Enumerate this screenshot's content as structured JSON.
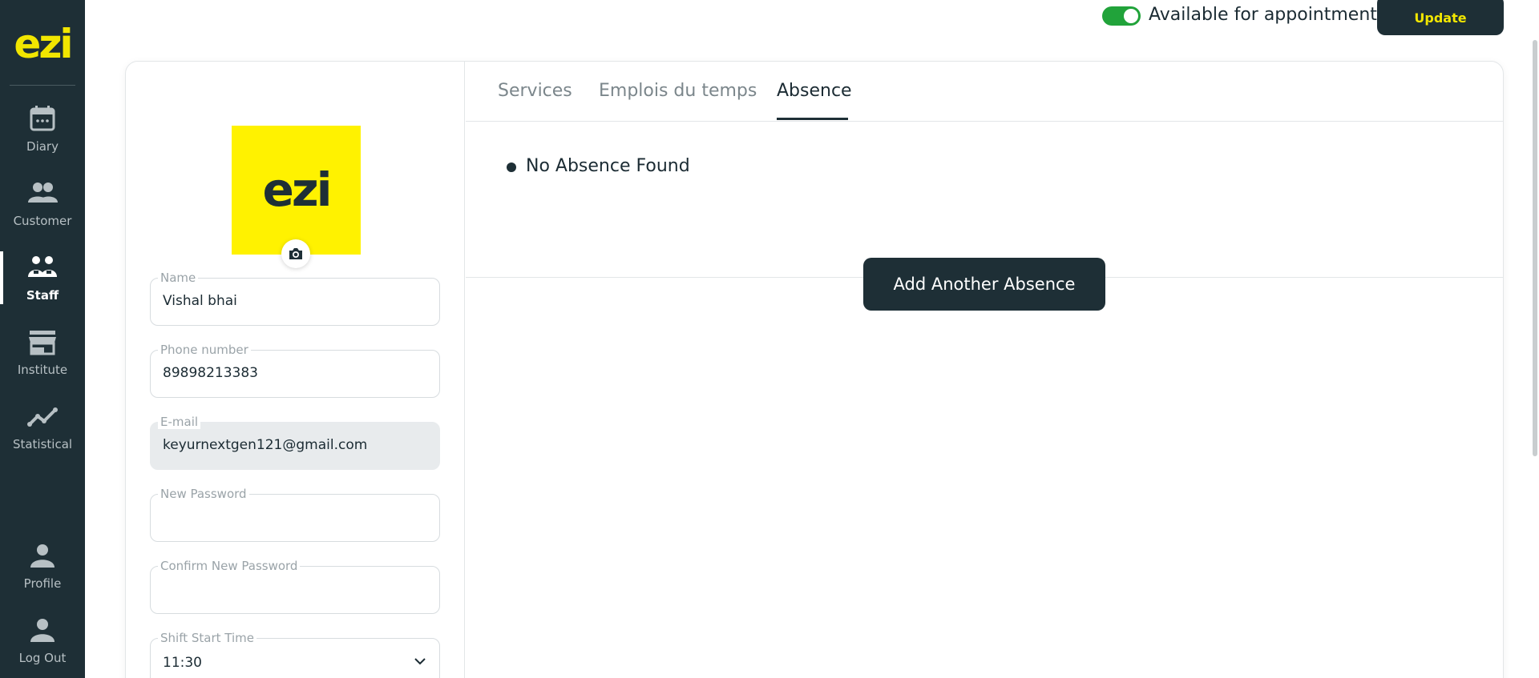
{
  "colors": {
    "sidebar": "#1e2f36",
    "brand_yellow": "#f2e600",
    "avatar_yellow": "#fff200",
    "logo_dark": "#1e2f36",
    "toggle_on": "#21a33a"
  },
  "sidebar": {
    "logo": "ezi",
    "items": [
      {
        "label": "Diary",
        "icon": "calendar-icon"
      },
      {
        "label": "Customer",
        "icon": "customers-icon"
      },
      {
        "label": "Staff",
        "icon": "staff-icon",
        "active": true
      },
      {
        "label": "Institute",
        "icon": "store-icon"
      },
      {
        "label": "Statistical",
        "icon": "chart-line-icon"
      }
    ],
    "bottom_items": [
      {
        "label": "Profile",
        "icon": "user-icon"
      },
      {
        "label": "Log Out",
        "icon": "user-icon"
      }
    ]
  },
  "topbar": {
    "availability_label": "Available for appointment",
    "availability_on": true,
    "update_label": "Update"
  },
  "profile": {
    "avatar_text": "ezi",
    "fields": {
      "name": {
        "label": "Name",
        "value": "Vishal bhai"
      },
      "phone": {
        "label": "Phone number",
        "value": "89898213383"
      },
      "email": {
        "label": "E-mail",
        "value": "keyurnextgen121@gmail.com"
      },
      "new_password": {
        "label": "New Password",
        "value": ""
      },
      "confirm_password": {
        "label": "Confirm New Password",
        "value": ""
      },
      "shift_start": {
        "label": "Shift Start Time",
        "value": "11:30"
      }
    }
  },
  "tabs": [
    {
      "label": "Services"
    },
    {
      "label": "Emplois du temps"
    },
    {
      "label": "Absence",
      "active": true
    }
  ],
  "absence": {
    "empty_message": "No Absence Found",
    "add_button": "Add Another Absence"
  }
}
